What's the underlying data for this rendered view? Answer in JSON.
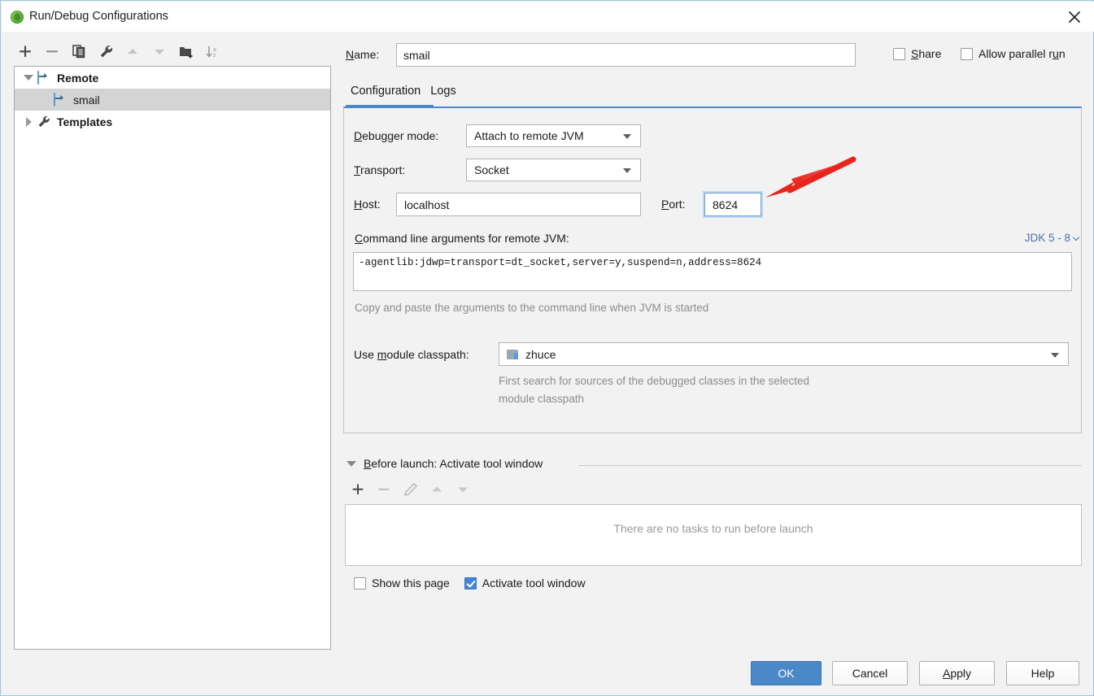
{
  "window": {
    "title": "Run/Debug Configurations",
    "app_icon": "intellij-green-icon",
    "close_icon": "close-icon"
  },
  "sidebar": {
    "toolbar": [
      {
        "name": "add-configuration-button",
        "icon": "plus-icon",
        "enabled": true
      },
      {
        "name": "remove-configuration-button",
        "icon": "minus-icon",
        "enabled": true
      },
      {
        "name": "copy-configuration-button",
        "icon": "copy-icon",
        "enabled": true
      },
      {
        "name": "edit-templates-button",
        "icon": "wrench-icon",
        "enabled": true
      },
      {
        "name": "move-up-button",
        "icon": "arrow-up-icon",
        "enabled": false
      },
      {
        "name": "move-down-button",
        "icon": "arrow-down-icon",
        "enabled": false
      },
      {
        "name": "new-folder-button",
        "icon": "folder-add-icon",
        "enabled": true
      },
      {
        "name": "sort-configurations-button",
        "icon": "sort-az-icon",
        "enabled": true
      }
    ],
    "tree": [
      {
        "label": "Remote",
        "icon": "remote-config-icon",
        "expanded": true,
        "level": 0,
        "selected": false
      },
      {
        "label": "smail",
        "icon": "remote-config-icon",
        "level": 1,
        "selected": true
      },
      {
        "label": "Templates",
        "icon": "wrench-icon",
        "expanded": false,
        "level": 0,
        "selected": false
      }
    ]
  },
  "header": {
    "name_label": "Name:",
    "name_value": "smail",
    "name_placeholder": "",
    "share_label": "Share",
    "share_checked": false,
    "parallel_label": "Allow parallel run",
    "parallel_checked": false
  },
  "tabs": [
    {
      "label": "Configuration",
      "active": true
    },
    {
      "label": "Logs",
      "active": false
    }
  ],
  "configuration": {
    "debugger_mode_label": "Debugger mode:",
    "debugger_mode_value": "Attach to remote JVM",
    "transport_label": "Transport:",
    "transport_value": "Socket",
    "host_label": "Host:",
    "host_value": "localhost",
    "port_label": "Port:",
    "port_value": "8624",
    "args_label": "Command line arguments for remote JVM:",
    "jdk_selector": "JDK 5 - 8",
    "args_value": "-agentlib:jdwp=transport=dt_socket,server=y,suspend=n,address=8624",
    "args_hint": "Copy and paste the arguments to the command line when JVM is started",
    "module_label": "Use module classpath:",
    "module_value": "zhuce",
    "module_icon": "module-folder-icon",
    "module_hint_line1": "First search for sources of the debugged classes in the selected",
    "module_hint_line2": "module classpath"
  },
  "before_launch": {
    "title": "Before launch: Activate tool window",
    "expanded": true,
    "toolbar": [
      {
        "name": "add-task-button",
        "icon": "plus-icon",
        "enabled": true
      },
      {
        "name": "remove-task-button",
        "icon": "minus-icon",
        "enabled": false
      },
      {
        "name": "edit-task-button",
        "icon": "pencil-icon",
        "enabled": false
      },
      {
        "name": "task-move-up-button",
        "icon": "arrow-up-icon",
        "enabled": false
      },
      {
        "name": "task-move-down-button",
        "icon": "arrow-down-icon",
        "enabled": false
      }
    ],
    "empty_text": "There are no tasks to run before launch",
    "show_page_label": "Show this page",
    "show_page_checked": false,
    "activate_window_label": "Activate tool window",
    "activate_window_checked": true
  },
  "footer": {
    "ok": "OK",
    "cancel": "Cancel",
    "apply": "Apply",
    "help": "Help"
  },
  "annotation": {
    "type": "red-arrow",
    "points_to": "port-input",
    "color": "#e8241d"
  },
  "colors": {
    "accent": "#4a88c7",
    "link": "#4b72a8",
    "selection": "#d4d4d4",
    "annotation_red": "#e8241d"
  }
}
